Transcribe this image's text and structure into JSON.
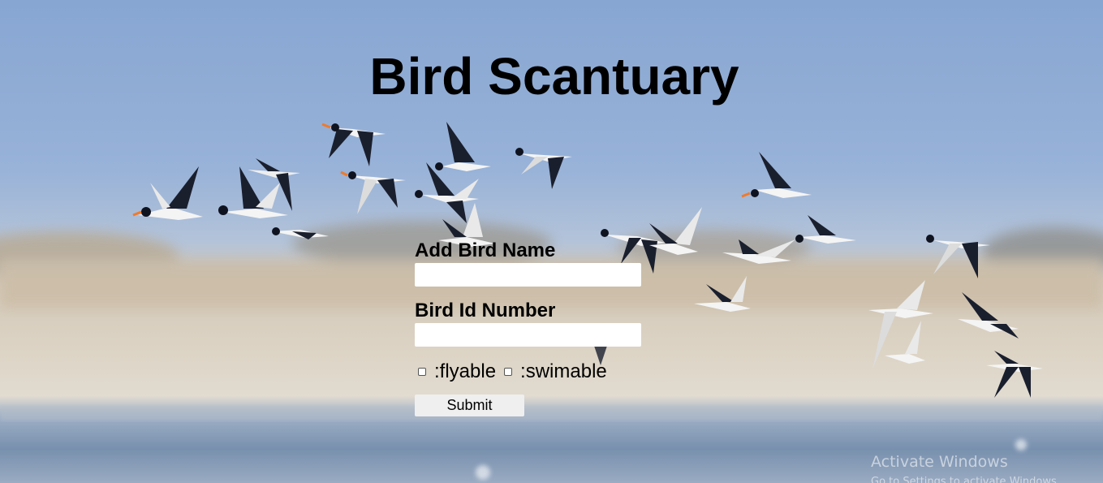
{
  "page": {
    "title": "Bird Scantuary"
  },
  "form": {
    "bird_name_label": "Add Bird Name",
    "bird_name_value": "",
    "bird_id_label": "Bird Id Number",
    "bird_id_value": "",
    "flyable_label": ":flyable",
    "flyable_checked": false,
    "swimable_label": ":swimable",
    "swimable_checked": false,
    "submit_label": "Submit"
  },
  "watermark": {
    "line1": "Activate Windows",
    "line2": "Go to Settings to activate Windows."
  },
  "colors": {
    "sky_top": "#8aa9d4",
    "sky_mid": "#a9bfdc",
    "dunes": "#cfc2ad",
    "water": "#7d95b3"
  },
  "background": {
    "subject": "flock-of-oystercatchers-flying-photo"
  }
}
